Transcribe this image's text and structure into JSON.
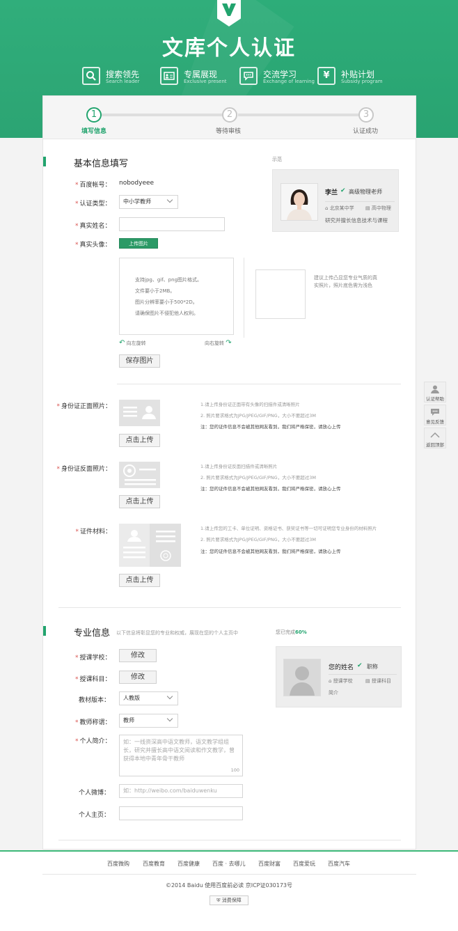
{
  "header": {
    "title": "文库个人认证",
    "features": [
      {
        "icon": "search-icon",
        "cn": "搜索领先",
        "en": "Search leader"
      },
      {
        "icon": "id-card-icon",
        "cn": "专属展现",
        "en": "Exclusive present"
      },
      {
        "icon": "chat-icon",
        "cn": "交流学习",
        "en": "Exchange of learning"
      },
      {
        "icon": "yuan-icon",
        "cn": "补贴计划",
        "en": "Subsidy program"
      }
    ]
  },
  "steps": [
    {
      "num": "1",
      "label": "填写信息",
      "active": true
    },
    {
      "num": "2",
      "label": "等待审核",
      "active": false
    },
    {
      "num": "3",
      "label": "认证成功",
      "active": false
    }
  ],
  "basic": {
    "title": "基本信息填写",
    "example_label": "示范",
    "baidu_label": "百度帐号：",
    "baidu_value": "nobodyeee",
    "type_label": "认证类型：",
    "type_value": "中小学教师",
    "name_label": "真实姓名：",
    "name_value": "",
    "avatar_label": "真实头像：",
    "upload_btn": "上传图片",
    "upload_tips": [
      "支持jpg、gif、png图片格式。",
      "文件要小于2MB。",
      "图片分辨率要小于500*2D。",
      "请确保图片不侵犯他人权利。"
    ],
    "rotate_left": "向左旋转",
    "rotate_right": "向右旋转",
    "preview_tip": "建议上传凸显您专业气质的真实照片，照片底色需为浅色",
    "save_btn": "保存图片",
    "example": {
      "name": "李兰",
      "title": "高级物理老师",
      "school": "北京某中学",
      "subject": "高中物理",
      "desc": "研究并擅长信息技术与课程"
    }
  },
  "ids": {
    "front_label": "身份证正面照片：",
    "back_label": "身份证反面照片：",
    "material_label": "证件材料：",
    "upload_btn": "点击上传",
    "front_notes": [
      "1.请上传身份证正面带有头像的扫描件或清晰照片",
      "2. 照片要求格式为JPG/JPEG/GIF/PNG，大小不要超过3M"
    ],
    "back_notes": [
      "1.请上传身份证反面扫描件或清晰照片",
      "2. 照片要求格式为JPG/JPEG/GIF/PNG，大小不要超过3M"
    ],
    "material_notes": [
      "1.请上传您的工卡、单位证明、资格证书、获奖证书等一切可证明您专业身份的材料照片",
      "2. 照片要求格式为JPG/JPEG/GIF/PNG，大小不要超过3M"
    ],
    "privacy_note": "注：您的证件信息不会被其他网友看到，我们将严格保密，请放心上传"
  },
  "pro": {
    "title": "专业信息",
    "subtitle": "以下信息将彰显您的专业和权威，展现在您的个人主页中",
    "progress_prefix": "您已完成",
    "progress_value": "60%",
    "school_label": "授课学校：",
    "subject_label": "授课科目：",
    "modify_btn": "修改",
    "textbook_label": "教材版本：",
    "textbook_value": "人教版",
    "rank_label": "教师称谓：",
    "rank_value": "教师",
    "intro_label": "个人简介：",
    "intro_placeholder": "如：一线资深高中语文教师，语文教学组组长，研究并擅长高中语文阅读和作文教学，曾获得本地中青年骨干教师",
    "intro_count": "100",
    "weibo_label": "个人微博：",
    "weibo_placeholder": "如：http://weibo.com/baiduwenku",
    "home_label": "个人主页：",
    "preview": {
      "name": "您的姓名",
      "title": "职称",
      "school": "授课学校",
      "subject": "授课科目",
      "intro": "简介"
    }
  },
  "side_tools": [
    {
      "icon": "user-help-icon",
      "label": "认证帮助"
    },
    {
      "icon": "feedback-icon",
      "label": "意见反馈"
    },
    {
      "icon": "arrow-up-icon",
      "label": "返回顶部"
    }
  ],
  "footer": {
    "links": [
      "百度微购",
      "百度教育",
      "百度健康",
      "百度 · 去哪儿",
      "百度财富",
      "百度爱玩",
      "百度汽车"
    ],
    "copyright": "©2014 Baidu 使用百度前必读 京ICP证030173号",
    "badge": "消费保障"
  },
  "colors": {
    "brand": "#22a46e",
    "required": "#d9534f"
  }
}
